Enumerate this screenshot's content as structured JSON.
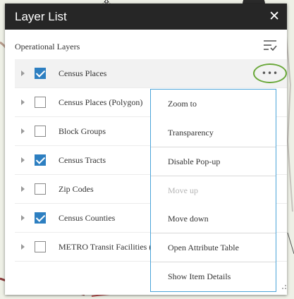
{
  "panel": {
    "title": "Layer List",
    "section_label": "Operational Layers"
  },
  "layers": [
    {
      "name": "Census Places",
      "checked": true
    },
    {
      "name": "Census Places (Polygon)",
      "checked": false
    },
    {
      "name": "Block Groups",
      "checked": false
    },
    {
      "name": "Census Tracts",
      "checked": true
    },
    {
      "name": "Zip Codes",
      "checked": false
    },
    {
      "name": "Census Counties",
      "checked": true
    },
    {
      "name": "METRO Transit Facilities (2",
      "checked": false
    }
  ],
  "menu": {
    "zoom_to": "Zoom to",
    "transparency": "Transparency",
    "disable_popup": "Disable Pop-up",
    "move_up": "Move up",
    "move_down": "Move down",
    "open_attribute_table": "Open Attribute Table",
    "show_item_details": "Show Item Details"
  },
  "icons": {
    "close": "close-icon",
    "filter": "list-filter-icon",
    "more": "more-options-icon"
  },
  "colors": {
    "header": "#262626",
    "checkbox": "#2d7fc1",
    "highlight_ring": "#6aa83a",
    "menu_border": "#4aa3d8"
  }
}
